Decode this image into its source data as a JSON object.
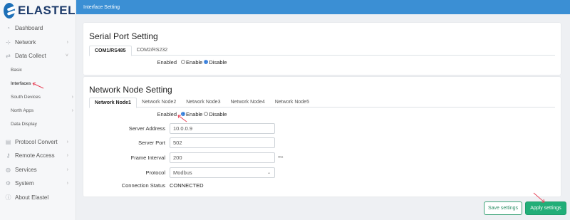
{
  "logo": {
    "text": "ELASTEL"
  },
  "topbar": {
    "title": "Interface Setting"
  },
  "sidebar": {
    "items": [
      {
        "label": "Dashboard",
        "icon": "dashboard-icon"
      },
      {
        "label": "Network",
        "icon": "network-icon",
        "has_children": true
      },
      {
        "label": "Data Collect",
        "icon": "data-collect-icon",
        "expanded": true
      }
    ],
    "sub_items": [
      {
        "label": "Basic"
      },
      {
        "label": "Interfaces",
        "active": true
      },
      {
        "label": "South Devices",
        "has_children": true
      },
      {
        "label": "North Apps",
        "has_children": true
      },
      {
        "label": "Data Display"
      }
    ],
    "items_after": [
      {
        "label": "Protocol Convert",
        "icon": "protocol-convert-icon",
        "has_children": true
      },
      {
        "label": "Remote Access",
        "icon": "remote-access-icon",
        "has_children": true
      },
      {
        "label": "Services",
        "icon": "services-icon",
        "has_children": true
      },
      {
        "label": "System",
        "icon": "system-icon",
        "has_children": true
      },
      {
        "label": "About Elastel",
        "icon": "info-icon"
      }
    ]
  },
  "serial": {
    "title": "Serial Port Setting",
    "tabs": [
      "COM1/RS485",
      "COM2/RS232"
    ],
    "active_tab": 0,
    "enabled_label": "Enabled",
    "enable_option": "Enable",
    "disable_option": "Disable",
    "selected": "Disable"
  },
  "network_node": {
    "title": "Network Node Setting",
    "tabs": [
      "Network Node1",
      "Network Node2",
      "Network Node3",
      "Network Node4",
      "Network Node5"
    ],
    "active_tab": 0,
    "enabled_label": "Enabled",
    "enable_option": "Enable",
    "disable_option": "Disable",
    "selected": "Enable",
    "server_address_label": "Server Address",
    "server_address": "10.0.0.9",
    "server_port_label": "Server Port",
    "server_port": "502",
    "frame_interval_label": "Frame Interval",
    "frame_interval": "200",
    "frame_interval_unit": "ms",
    "protocol_label": "Protocol",
    "protocol": "Modbus",
    "connection_status_label": "Connection Status",
    "connection_status": "CONNECTED"
  },
  "buttons": {
    "save": "Save settings",
    "apply": "Apply settings"
  },
  "colors": {
    "topbar": "#3b8fd4",
    "apply": "#22ae78",
    "annotation_arrow": "#e8455a"
  }
}
